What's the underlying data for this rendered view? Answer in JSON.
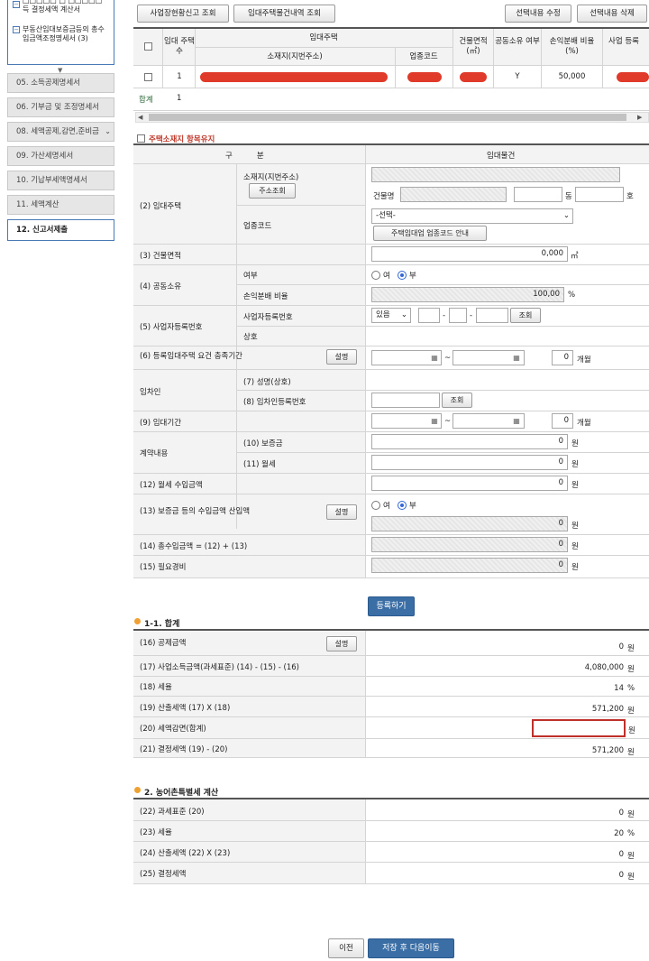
{
  "sidebar": {
    "sub_items": [
      {
        "label": "□□□□□ □ □□□□□ 득 결정세액 계산서"
      },
      {
        "label": "부동산임대보증금등의 총수입금액조정명세서 (3)"
      }
    ],
    "nav": [
      {
        "label": "05. 소득공제명세서"
      },
      {
        "label": "06. 기부금 및 조정명세서"
      },
      {
        "label": "08. 세액공제,감면,준비금"
      },
      {
        "label": "09. 가산세명세서"
      },
      {
        "label": "10. 기납부세액명세서"
      },
      {
        "label": "11. 세액계산"
      },
      {
        "label": "12. 신고서제출"
      }
    ]
  },
  "toolbar": {
    "btn_status": "사업장현황신고 조회",
    "btn_rental": "임대주택물건내역 조회",
    "btn_edit": "선택내용 수정",
    "btn_delete": "선택내용 삭제"
  },
  "list_table": {
    "headers": {
      "count": "임대 주택수",
      "house": "임대주택",
      "address": "소재지(지번주소)",
      "biz_code": "업종코드",
      "area": "건물면적 (㎡)",
      "joint": "공동소유 여부",
      "ratio": "손익분배 비율 (%)",
      "biz_no": "사업 등록"
    },
    "row": {
      "count": "1",
      "joint": "Y",
      "ratio": "50,000"
    },
    "total_label": "합계",
    "total_count": "1"
  },
  "form": {
    "keep_label": "주택소재지 항목유지",
    "col_category": "구          분",
    "col_property": "임대물건",
    "r2": "(2) 임대주택",
    "r2_addr": "소재지(지번주소)",
    "r2_addr_btn": "주소조회",
    "r2_building": "건물명",
    "r2_dong": "동",
    "r2_ho": "호",
    "r2_bizcode": "업종코드",
    "r2_select": "-선택-",
    "r2_guide_btn": "주택임대업 업종코드 안내",
    "r3": "(3) 건물면적",
    "r3_val": "0,000",
    "r3_unit": "㎡",
    "r4": "(4) 공동소유",
    "r4_yn": "여부",
    "r4_ratio": "손익분배 비율",
    "r4_ratio_val": "100,00",
    "r4_ratio_unit": "%",
    "yes": "여",
    "no": "부",
    "r5": "(5) 사업자등록번호",
    "r5_no": "사업자등록번호",
    "r5_name": "상호",
    "r5_select": "있음",
    "r5_btn": "조회",
    "r6": "(6) 등록임대주택 요건 충족기간",
    "explain_btn": "설명",
    "tilde": "~",
    "months_val": "0",
    "months_unit": "개월",
    "tenant": "임차인",
    "r7": "(7) 성명(상호)",
    "r8": "(8) 임차인등록번호",
    "r8_btn": "조회",
    "r9": "(9) 임대기간",
    "contract": "계약내용",
    "r10": "(10) 보증금",
    "r11": "(11) 월세",
    "r12": "(12) 월세 수입금액",
    "r13": "(13) 보증금 등의 수입금액 산입액",
    "r14": "(14) 총수입금액 = (12) + (13)",
    "r15": "(15) 필요경비",
    "zero": "0",
    "won": "원",
    "register_btn": "등록하기"
  },
  "summary": {
    "title": "1-1. 합계",
    "rows": [
      {
        "label": "(16) 공제금액",
        "value": "0",
        "unit": "원"
      },
      {
        "label": "(17) 사업소득금액(과세표준) (14) - (15) - (16)",
        "value": "4,080,000",
        "unit": "원"
      },
      {
        "label": "(18) 세율",
        "value": "14",
        "unit": "%"
      },
      {
        "label": "(19) 산출세액 (17) X (18)",
        "value": "571,200",
        "unit": "원"
      },
      {
        "label": "(20) 세액감면(합계)",
        "value": "",
        "unit": "원"
      },
      {
        "label": "(21) 결정세액 (19) - (20)",
        "value": "571,200",
        "unit": "원"
      }
    ]
  },
  "rural": {
    "title": "2. 농어촌특별세 계산",
    "rows": [
      {
        "label": "(22) 과세표준 (20)",
        "value": "0",
        "unit": "원"
      },
      {
        "label": "(23) 세율",
        "value": "20",
        "unit": "%"
      },
      {
        "label": "(24) 산출세액 (22) X (23)",
        "value": "0",
        "unit": "원"
      },
      {
        "label": "(25) 결정세액",
        "value": "0",
        "unit": "원"
      }
    ]
  },
  "footer": {
    "prev": "이전",
    "save_next": "저장 후 다음이동"
  }
}
